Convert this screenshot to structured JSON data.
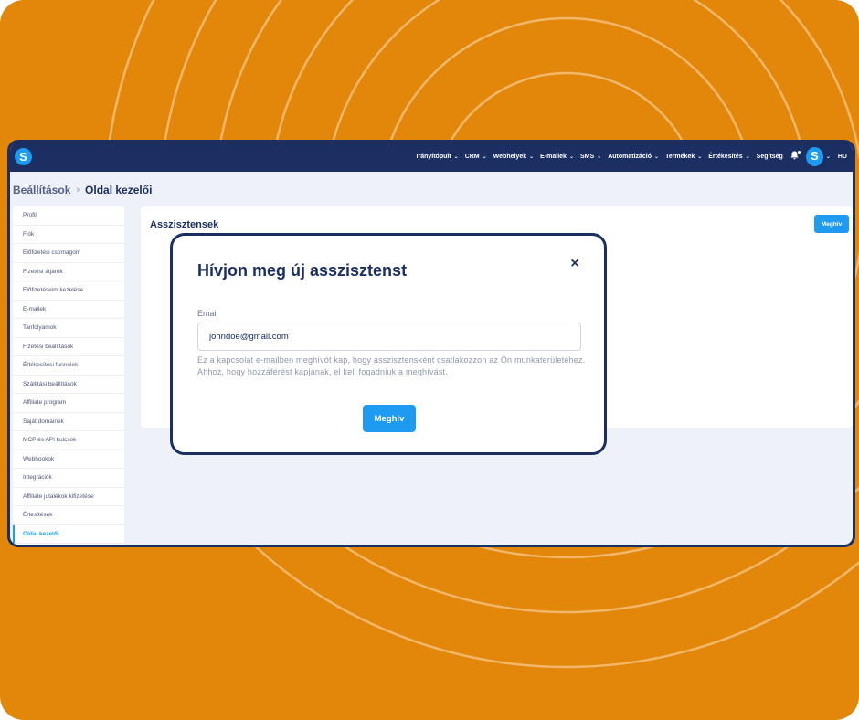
{
  "colors": {
    "background": "#e3870a",
    "navy": "#1c2f62",
    "accent": "#1d9bf0"
  },
  "topbar": {
    "logo_letter": "S",
    "nav": [
      {
        "label": "Irányítópult",
        "dropdown": true
      },
      {
        "label": "CRM",
        "dropdown": true
      },
      {
        "label": "Webhelyek",
        "dropdown": true
      },
      {
        "label": "E-mailek",
        "dropdown": true
      },
      {
        "label": "SMS",
        "dropdown": true
      },
      {
        "label": "Automatizáció",
        "dropdown": true
      },
      {
        "label": "Termékek",
        "dropdown": true
      },
      {
        "label": "Értékesítés",
        "dropdown": true
      },
      {
        "label": "Segítség",
        "dropdown": false
      }
    ],
    "icons": {
      "notifications": "bell-icon",
      "dropdown": "chevron-down-icon"
    },
    "avatar_letter": "S",
    "language": "HU"
  },
  "breadcrumb": {
    "parent": "Beállítások",
    "separator": "›",
    "current": "Oldal kezelői"
  },
  "sidebar": {
    "items": [
      {
        "label": "Profil"
      },
      {
        "label": "Fiók"
      },
      {
        "label": "Előfizetési csomagom"
      },
      {
        "label": "Fizetési átjárók"
      },
      {
        "label": "Előfizetéseim kezelése"
      },
      {
        "label": "E-mailek"
      },
      {
        "label": "Tanfolyamok"
      },
      {
        "label": "Fizetési beállítások"
      },
      {
        "label": "Értékesítési funnelek"
      },
      {
        "label": "Szállítási beállítások"
      },
      {
        "label": "Affiliate program"
      },
      {
        "label": "Saját domainek"
      },
      {
        "label": "MCP és API kulcsok"
      },
      {
        "label": "Webhookok"
      },
      {
        "label": "Integrációk"
      },
      {
        "label": "Affiliate jutalékok kifizetése"
      },
      {
        "label": "Értesítések"
      },
      {
        "label": "Oldal kezelői",
        "active": true
      }
    ]
  },
  "panel": {
    "title": "Asszisztensek",
    "invite_button": "Meghív"
  },
  "modal": {
    "title": "Hívjon meg új asszisztenst",
    "close_symbol": "×",
    "email_label": "Email",
    "email_value": "johndoe@gmail.com",
    "helper_text": "Ez a kapcsolat e-mailben meghívót kap, hogy asszisztensként csatlakozzon az Ön munkaterületéhez. Ahhoz, hogy hozzáférést kapjanak, el kell fogadniuk a meghívást.",
    "submit_button": "Meghív"
  }
}
